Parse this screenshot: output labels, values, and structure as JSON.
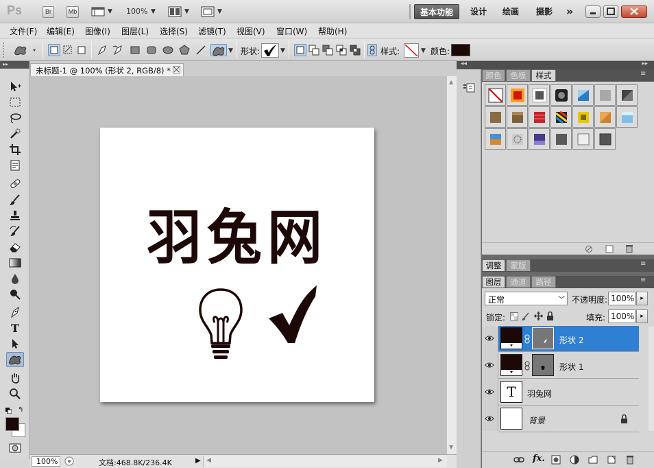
{
  "app": {
    "logo": "Ps",
    "bridge_label": "Br",
    "minibridge_label": "Mb",
    "zoom": "100%",
    "workspaces": [
      "基本功能",
      "设计",
      "绘画",
      "摄影"
    ],
    "more": "»"
  },
  "menu": [
    "文件(F)",
    "编辑(E)",
    "图像(I)",
    "图层(L)",
    "选择(S)",
    "滤镜(T)",
    "视图(V)",
    "窗口(W)",
    "帮助(H)"
  ],
  "options": {
    "shape_label": "形状:",
    "style_label": "样式:",
    "color_label": "颜色:",
    "color": "#1c0907"
  },
  "document": {
    "tab_title": "未标题-1 @ 100% (形状 2, RGB/8) *",
    "canvas_text": "羽兔网",
    "text_color": "#1c0907"
  },
  "status": {
    "zoom": "100%",
    "doc_info": "文档:468.8K/236.4K"
  },
  "panels": {
    "top_tabs": [
      "颜色",
      "色板",
      "样式"
    ],
    "mid_tabs": [
      "调整",
      "蒙版"
    ],
    "layer_tabs": [
      "图层",
      "通道",
      "路径"
    ],
    "blend_mode": "正常",
    "opacity_label": "不透明度:",
    "opacity": "100%",
    "lock_label": "锁定:",
    "fill_label": "填充:",
    "fill": "100%"
  },
  "layers": [
    {
      "name": "形状 2",
      "selected": true
    },
    {
      "name": "形状 1",
      "selected": false
    },
    {
      "name": "羽兔网",
      "selected": false
    },
    {
      "name": "背景",
      "selected": false
    }
  ],
  "colors": {
    "foreground": "#1c0907",
    "background": "#ffffff",
    "selection": "#2f7fd3",
    "accent": "#6e8fb5"
  }
}
